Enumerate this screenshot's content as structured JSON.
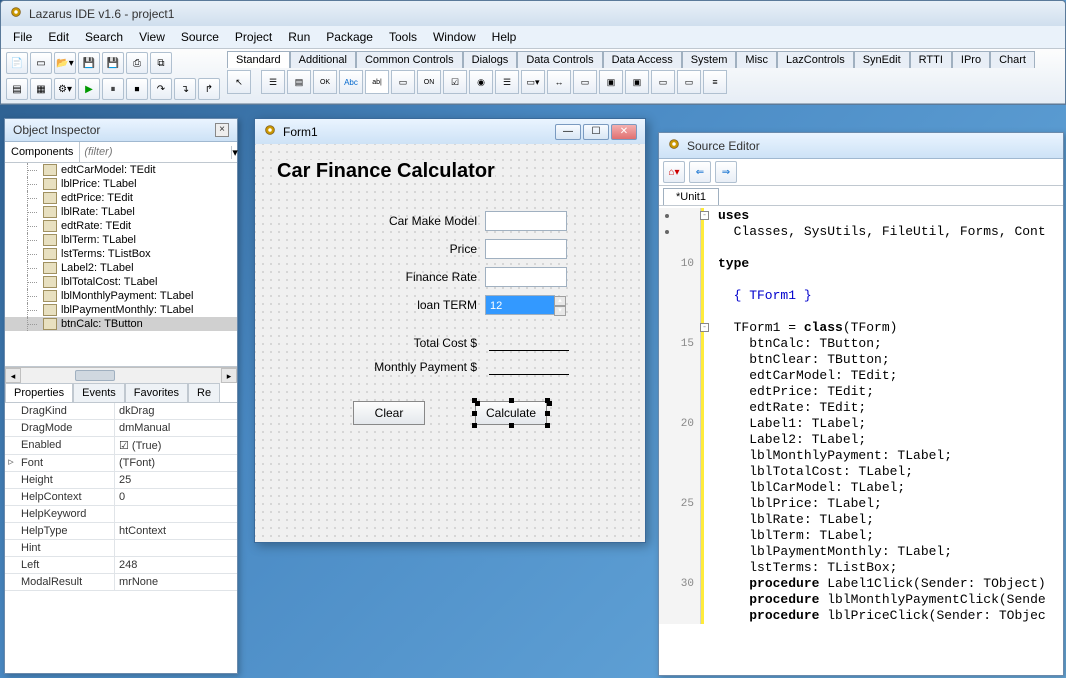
{
  "main_title": "Lazarus IDE v1.6 - project1",
  "menu": [
    "File",
    "Edit",
    "Search",
    "View",
    "Source",
    "Project",
    "Run",
    "Package",
    "Tools",
    "Window",
    "Help"
  ],
  "palette_tabs": [
    "Standard",
    "Additional",
    "Common Controls",
    "Dialogs",
    "Data Controls",
    "Data Access",
    "System",
    "Misc",
    "LazControls",
    "SynEdit",
    "RTTI",
    "IPro",
    "Chart"
  ],
  "inspector": {
    "title": "Object Inspector",
    "components_label": "Components",
    "filter_placeholder": "(filter)",
    "tree": [
      "edtCarModel: TEdit",
      "lblPrice: TLabel",
      "edtPrice: TEdit",
      "lblRate: TLabel",
      "edtRate: TEdit",
      "lblTerm: TLabel",
      "lstTerms: TListBox",
      "Label2: TLabel",
      "lblTotalCost: TLabel",
      "lblMonthlyPayment: TLabel",
      "lblPaymentMonthly: TLabel",
      "btnCalc: TButton"
    ],
    "prop_tabs": [
      "Properties",
      "Events",
      "Favorites",
      "Re"
    ],
    "props": [
      {
        "k": "DragKind",
        "v": "dkDrag"
      },
      {
        "k": "DragMode",
        "v": "dmManual"
      },
      {
        "k": "Enabled",
        "v": "(True)",
        "check": true
      },
      {
        "k": "Font",
        "v": "(TFont)",
        "expand": true
      },
      {
        "k": "Height",
        "v": "25"
      },
      {
        "k": "HelpContext",
        "v": "0"
      },
      {
        "k": "HelpKeyword",
        "v": ""
      },
      {
        "k": "HelpType",
        "v": "htContext"
      },
      {
        "k": "Hint",
        "v": ""
      },
      {
        "k": "Left",
        "v": "248"
      },
      {
        "k": "ModalResult",
        "v": "mrNone"
      }
    ]
  },
  "form1": {
    "title": "Form1",
    "heading": "Car Finance Calculator",
    "labels": {
      "model": "Car Make Model",
      "price": "Price",
      "rate": "Finance Rate",
      "term": "loan TERM",
      "total": "Total Cost  $",
      "monthly": "Monthly Payment $"
    },
    "term_value": "12",
    "btn_clear": "Clear",
    "btn_calc": "Calculate"
  },
  "source": {
    "title": "Source Editor",
    "tab": "*Unit1",
    "lines": [
      {
        "n": "",
        "dot": true,
        "fold": "-",
        "txt": [
          {
            "t": "uses",
            "c": "kw"
          }
        ]
      },
      {
        "n": "",
        "dot": true,
        "txt": [
          {
            "t": "  Classes, SysUtils, FileUtil, Forms, Cont",
            "c": "cls"
          }
        ]
      },
      {
        "n": "",
        "txt": [
          {
            "t": "",
            "c": ""
          }
        ]
      },
      {
        "n": "10",
        "txt": [
          {
            "t": "type",
            "c": "kw"
          }
        ]
      },
      {
        "n": "",
        "txt": [
          {
            "t": "",
            "c": ""
          }
        ]
      },
      {
        "n": "",
        "txt": [
          {
            "t": "  { TForm1 }",
            "c": "cmt"
          }
        ]
      },
      {
        "n": "",
        "txt": [
          {
            "t": "",
            "c": ""
          }
        ]
      },
      {
        "n": "",
        "fold": "-",
        "txt": [
          {
            "t": "  TForm1 = ",
            "c": "cls"
          },
          {
            "t": "class",
            "c": "kw"
          },
          {
            "t": "(TForm)",
            "c": "cls"
          }
        ]
      },
      {
        "n": "15",
        "txt": [
          {
            "t": "    btnCalc: TButton;",
            "c": "cls"
          }
        ]
      },
      {
        "n": "",
        "txt": [
          {
            "t": "    btnClear: TButton;",
            "c": "cls"
          }
        ]
      },
      {
        "n": "",
        "txt": [
          {
            "t": "    edtCarModel: TEdit;",
            "c": "cls"
          }
        ]
      },
      {
        "n": "",
        "txt": [
          {
            "t": "    edtPrice: TEdit;",
            "c": "cls"
          }
        ]
      },
      {
        "n": "",
        "txt": [
          {
            "t": "    edtRate: TEdit;",
            "c": "cls"
          }
        ]
      },
      {
        "n": "20",
        "txt": [
          {
            "t": "    Label1: TLabel;",
            "c": "cls"
          }
        ]
      },
      {
        "n": "",
        "txt": [
          {
            "t": "    Label2: TLabel;",
            "c": "cls"
          }
        ]
      },
      {
        "n": "",
        "txt": [
          {
            "t": "    lblMonthlyPayment: TLabel;",
            "c": "cls"
          }
        ]
      },
      {
        "n": "",
        "txt": [
          {
            "t": "    lblTotalCost: TLabel;",
            "c": "cls"
          }
        ]
      },
      {
        "n": "",
        "txt": [
          {
            "t": "    lblCarModel: TLabel;",
            "c": "cls"
          }
        ]
      },
      {
        "n": "25",
        "txt": [
          {
            "t": "    lblPrice: TLabel;",
            "c": "cls"
          }
        ]
      },
      {
        "n": "",
        "txt": [
          {
            "t": "    lblRate: TLabel;",
            "c": "cls"
          }
        ]
      },
      {
        "n": "",
        "txt": [
          {
            "t": "    lblTerm: TLabel;",
            "c": "cls"
          }
        ]
      },
      {
        "n": "",
        "txt": [
          {
            "t": "    lblPaymentMonthly: TLabel;",
            "c": "cls"
          }
        ]
      },
      {
        "n": "",
        "txt": [
          {
            "t": "    lstTerms: TListBox;",
            "c": "cls"
          }
        ]
      },
      {
        "n": "30",
        "txt": [
          {
            "t": "    ",
            "c": ""
          },
          {
            "t": "procedure",
            "c": "kw"
          },
          {
            "t": " Label1Click(Sender: TObject)",
            "c": "cls"
          }
        ]
      },
      {
        "n": "",
        "txt": [
          {
            "t": "    ",
            "c": ""
          },
          {
            "t": "procedure",
            "c": "kw"
          },
          {
            "t": " lblMonthlyPaymentClick(Sende",
            "c": "cls"
          }
        ]
      },
      {
        "n": "",
        "txt": [
          {
            "t": "    ",
            "c": ""
          },
          {
            "t": "procedure",
            "c": "kw"
          },
          {
            "t": " lblPriceClick(Sender: TObjec",
            "c": "cls"
          }
        ]
      }
    ]
  }
}
